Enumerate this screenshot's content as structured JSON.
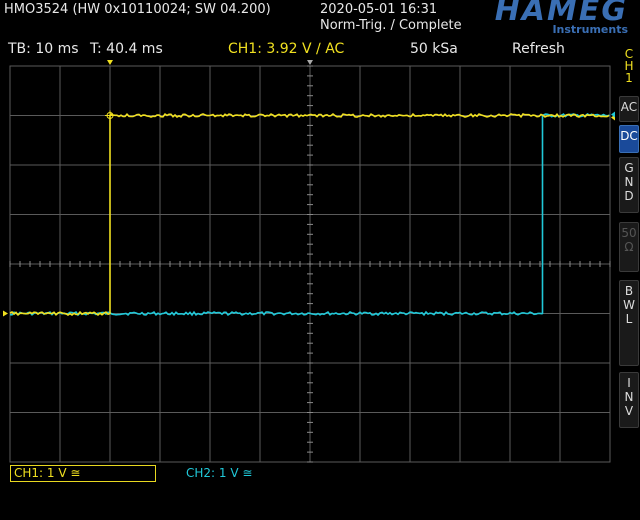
{
  "header": {
    "device_info": "HMO3524 (HW 0x10110024; SW 04.200)",
    "datetime": "2020-05-01 16:31",
    "trigger_status": "Norm-Trig. / Complete",
    "brand": "HAMEG",
    "brand_sub": "Instruments"
  },
  "status_bar": {
    "timebase": "TB: 10 ms",
    "trigger_time": "T: 40.4 ms",
    "ch1_trigger": "CH1: 3.92 V ∕ AC",
    "sample_rate": "50 kSa",
    "acquisition_mode": "Refresh"
  },
  "side_menu": {
    "channel": [
      "C",
      "H",
      "1"
    ],
    "buttons": [
      {
        "label": [
          "AC"
        ],
        "state": "normal"
      },
      {
        "label": [
          "DC"
        ],
        "state": "active"
      },
      {
        "label": [
          "G",
          "N",
          "D"
        ],
        "state": "normal"
      },
      {
        "label": [
          "50",
          "Ω"
        ],
        "state": "disabled"
      },
      {
        "label": [
          "B",
          "W",
          "L"
        ],
        "state": "normal"
      },
      {
        "label": [
          "I",
          "N",
          "V"
        ],
        "state": "normal"
      }
    ]
  },
  "channels": {
    "ch1": "CH1: 1 V ≅",
    "ch2": "CH2: 1 V ≅"
  },
  "colors": {
    "ch1": "#f0e020",
    "ch2": "#20c8d8",
    "grid": "#5a5a5a",
    "brand": "#3a6fb5"
  },
  "display": {
    "time_divisions": 12,
    "voltage_divisions": 8,
    "ch1_low": -1,
    "ch1_high": 3,
    "ch2_low": -1,
    "ch2_high": 3,
    "ch1_rise_div": 2,
    "ch2_rise_div": 10.65
  }
}
